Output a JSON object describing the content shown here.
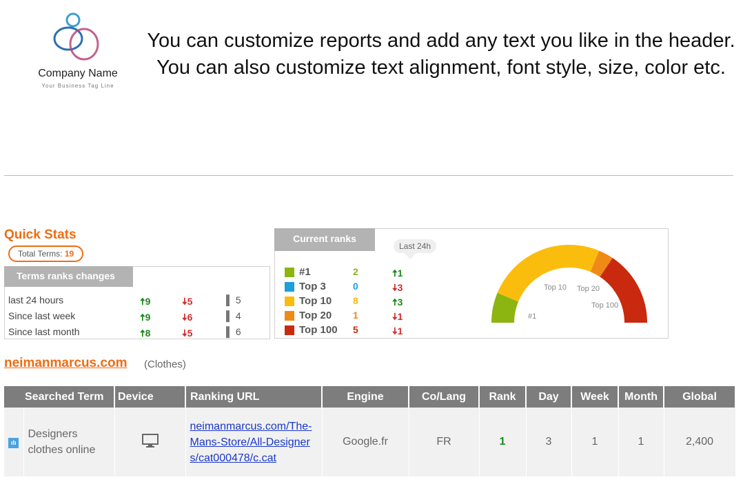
{
  "header": {
    "company_name": "Company Name",
    "tagline": "Your Business Tag Line",
    "text": "You can customize reports and add any text you like in the header. You can also customize text alignment, font style, size, color etc."
  },
  "quick_stats": {
    "title": "Quick Stats",
    "total_terms_label": "Total Terms:",
    "total_terms_value": "19",
    "ranks_changes_title": "Terms ranks changes",
    "rows": [
      {
        "label": "last 24 hours",
        "up": "9",
        "down": "5",
        "flat": "5"
      },
      {
        "label": "Since last week",
        "up": "9",
        "down": "6",
        "flat": "4"
      },
      {
        "label": "Since last month",
        "up": "8",
        "down": "5",
        "flat": "6"
      }
    ]
  },
  "current_ranks": {
    "title": "Current ranks",
    "period": "Last 24h",
    "rows": [
      {
        "label": "#1",
        "count": "2",
        "change": "1",
        "direction": "up",
        "color": "#8cb512"
      },
      {
        "label": "Top 3",
        "count": "0",
        "change": "3",
        "direction": "down",
        "color": "#1e9fd8"
      },
      {
        "label": "Top 10",
        "count": "8",
        "change": "3",
        "direction": "up",
        "color": "#fbbd0d"
      },
      {
        "label": "Top 20",
        "count": "1",
        "change": "1",
        "direction": "down",
        "color": "#f08a16"
      },
      {
        "label": "Top 100",
        "count": "5",
        "change": "1",
        "direction": "down",
        "color": "#c9290e"
      }
    ],
    "gauge_labels": [
      "#1",
      "Top 10",
      "Top 20",
      "Top 100"
    ]
  },
  "domain": {
    "name": "neimanmarcus.com",
    "category": "(Clothes)"
  },
  "table": {
    "columns": [
      "Searched Term",
      "Device",
      "Ranking URL",
      "Engine",
      "Co/Lang",
      "Rank",
      "Day",
      "Week",
      "Month",
      "Global"
    ],
    "rows": [
      {
        "engine_icon": "bar-chart-icon",
        "term": "Designers clothes online",
        "device": "desktop-monitor-icon",
        "url": "neimanmarcus.com/The-Mans-Store/All-Designers/cat000478/c.cat",
        "engine": "Google.fr",
        "co_lang": "FR",
        "rank": "1",
        "day": "3",
        "week": "1",
        "month": "1",
        "global": "2,400"
      }
    ]
  },
  "colors": {
    "accent": "#ef6c12",
    "up": "#1b8a1b",
    "down": "#d62b2b",
    "header_gray": "#b3b3b3",
    "table_header": "#7d7d7d"
  }
}
